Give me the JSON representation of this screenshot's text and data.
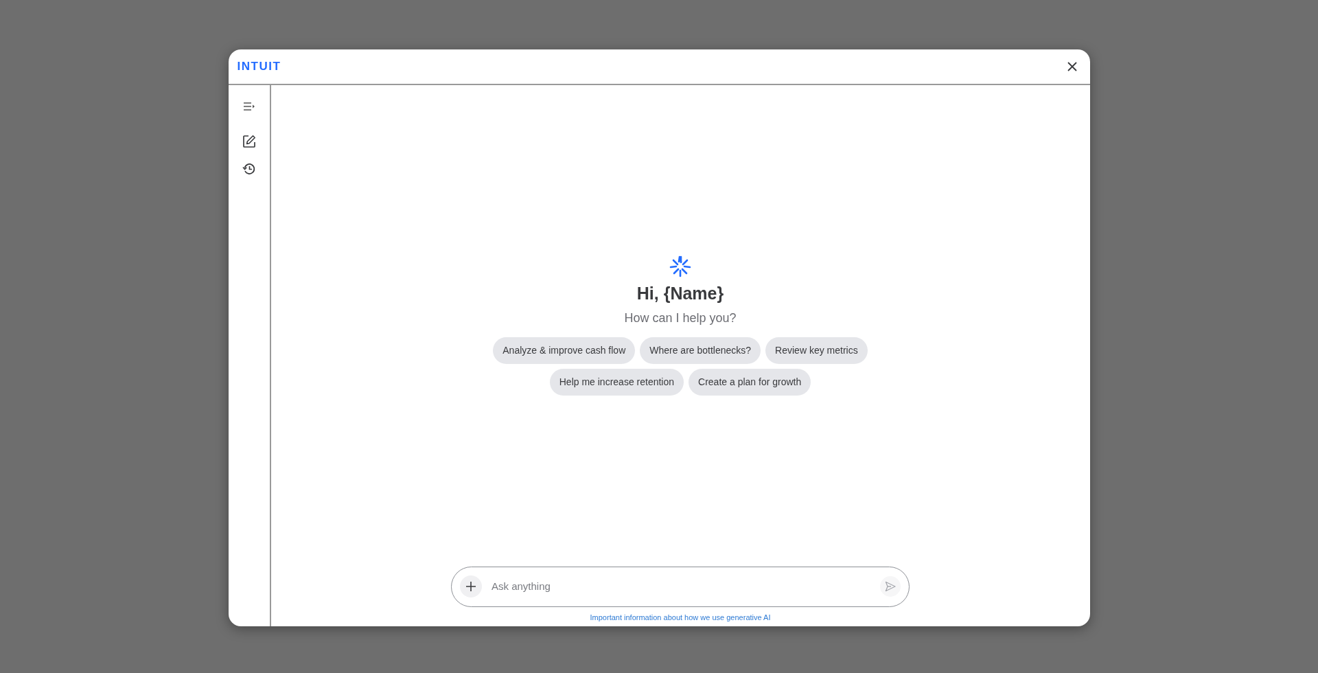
{
  "header": {
    "logo": "INTUIT"
  },
  "greeting": {
    "title": "Hi, {Name}",
    "subtitle": "How can I help you?"
  },
  "suggestions": [
    {
      "label": "Analyze & improve cash flow"
    },
    {
      "label": "Where are bottlenecks?"
    },
    {
      "label": "Review key metrics"
    },
    {
      "label": "Help me increase retention"
    },
    {
      "label": "Create a plan for growth"
    }
  ],
  "composer": {
    "placeholder": "Ask anything"
  },
  "footer_link": "Important information about how we use generative AI"
}
